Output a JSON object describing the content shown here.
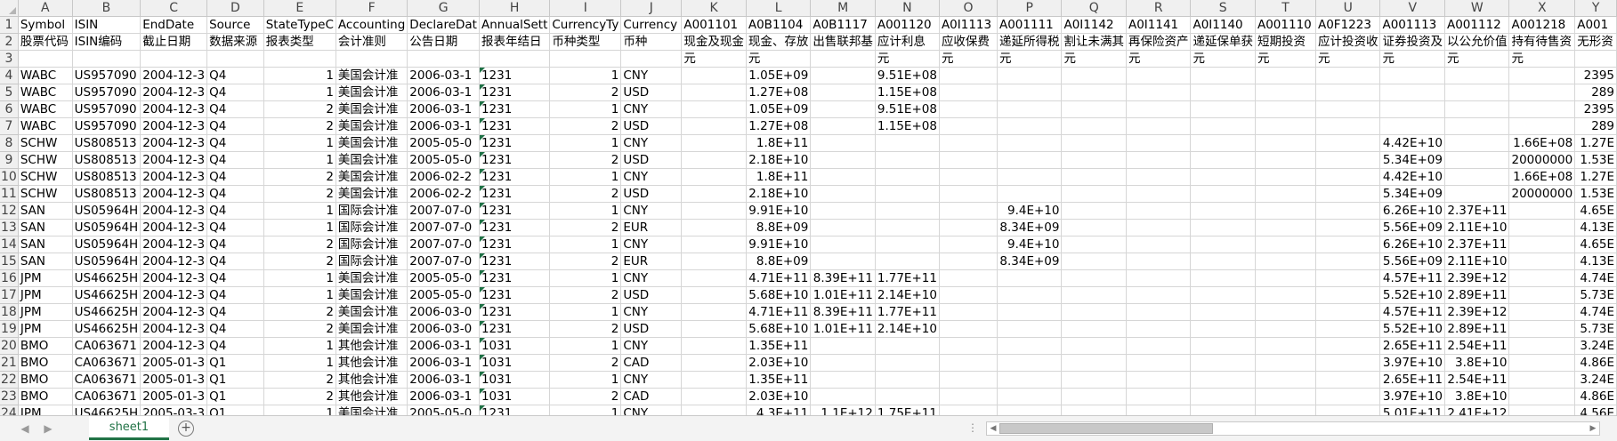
{
  "columns": [
    "A",
    "B",
    "C",
    "D",
    "E",
    "F",
    "G",
    "H",
    "I",
    "J",
    "K",
    "L",
    "M",
    "N",
    "O",
    "P",
    "Q",
    "R",
    "S",
    "T",
    "U",
    "V",
    "W",
    "X",
    "Y"
  ],
  "rows": [
    [
      "Symbol",
      "ISIN",
      "EndDate",
      "Source",
      "StateTypeC",
      "Accounting",
      "DeclareDat",
      "AnnualSett",
      "CurrencyTy",
      "Currency",
      "A001101",
      "A0B1104",
      "A0B1117",
      "A001120",
      "A0I1113",
      "A001111",
      "A0I1142",
      "A0I1141",
      "A0I1140",
      "A001110",
      "A0F1223",
      "A001113",
      "A001112",
      "A001218",
      "A001"
    ],
    [
      "股票代码",
      "ISIN编码",
      "截止日期",
      "数据来源",
      "报表类型",
      "会计准则",
      "公告日期",
      "报表年结日",
      "币种类型",
      "币种",
      "现金及现金",
      "现金、存放",
      "出售联邦基",
      "应计利息",
      "应收保费",
      "递延所得税",
      "割让未满其",
      "再保险资产",
      "递延保单获",
      "短期投资",
      "应计投资收",
      "证券投资及",
      "以公允价值",
      "持有待售资",
      "无形资"
    ],
    [
      "",
      "",
      "",
      "",
      "",
      "",
      "",
      "",
      "",
      "",
      "元",
      "元",
      "",
      "元",
      "元",
      "元",
      "元",
      "元",
      "元",
      "元",
      "元",
      "元",
      "元",
      "元",
      ""
    ],
    [
      "WABC",
      "US957090",
      "2004-12-3",
      "Q4",
      "1",
      "美国会计准",
      "2006-03-1",
      "1231",
      "1",
      "CNY",
      "",
      "1.05E+09",
      "",
      "9.51E+08",
      "",
      "",
      "",
      "",
      "",
      "",
      "",
      "",
      "",
      "",
      "2395"
    ],
    [
      "WABC",
      "US957090",
      "2004-12-3",
      "Q4",
      "1",
      "美国会计准",
      "2006-03-1",
      "1231",
      "2",
      "USD",
      "",
      "1.27E+08",
      "",
      "1.15E+08",
      "",
      "",
      "",
      "",
      "",
      "",
      "",
      "",
      "",
      "",
      "289"
    ],
    [
      "WABC",
      "US957090",
      "2004-12-3",
      "Q4",
      "2",
      "美国会计准",
      "2006-03-1",
      "1231",
      "1",
      "CNY",
      "",
      "1.05E+09",
      "",
      "9.51E+08",
      "",
      "",
      "",
      "",
      "",
      "",
      "",
      "",
      "",
      "",
      "2395"
    ],
    [
      "WABC",
      "US957090",
      "2004-12-3",
      "Q4",
      "2",
      "美国会计准",
      "2006-03-1",
      "1231",
      "2",
      "USD",
      "",
      "1.27E+08",
      "",
      "1.15E+08",
      "",
      "",
      "",
      "",
      "",
      "",
      "",
      "",
      "",
      "",
      "289"
    ],
    [
      "SCHW",
      "US808513",
      "2004-12-3",
      "Q4",
      "1",
      "美国会计准",
      "2005-05-0",
      "1231",
      "1",
      "CNY",
      "",
      "1.8E+11",
      "",
      "",
      "",
      "",
      "",
      "",
      "",
      "",
      "",
      "4.42E+10",
      "",
      "1.66E+08",
      "1.27E"
    ],
    [
      "SCHW",
      "US808513",
      "2004-12-3",
      "Q4",
      "1",
      "美国会计准",
      "2005-05-0",
      "1231",
      "2",
      "USD",
      "",
      "2.18E+10",
      "",
      "",
      "",
      "",
      "",
      "",
      "",
      "",
      "",
      "5.34E+09",
      "",
      "20000000",
      "1.53E"
    ],
    [
      "SCHW",
      "US808513",
      "2004-12-3",
      "Q4",
      "2",
      "美国会计准",
      "2006-02-2",
      "1231",
      "1",
      "CNY",
      "",
      "1.8E+11",
      "",
      "",
      "",
      "",
      "",
      "",
      "",
      "",
      "",
      "4.42E+10",
      "",
      "1.66E+08",
      "1.27E"
    ],
    [
      "SCHW",
      "US808513",
      "2004-12-3",
      "Q4",
      "2",
      "美国会计准",
      "2006-02-2",
      "1231",
      "2",
      "USD",
      "",
      "2.18E+10",
      "",
      "",
      "",
      "",
      "",
      "",
      "",
      "",
      "",
      "5.34E+09",
      "",
      "20000000",
      "1.53E"
    ],
    [
      "SAN",
      "US05964H",
      "2004-12-3",
      "Q4",
      "1",
      "国际会计准",
      "2007-07-0",
      "1231",
      "1",
      "CNY",
      "",
      "9.91E+10",
      "",
      "",
      "",
      "9.4E+10",
      "",
      "",
      "",
      "",
      "",
      "6.26E+10",
      "2.37E+11",
      "",
      "4.65E"
    ],
    [
      "SAN",
      "US05964H",
      "2004-12-3",
      "Q4",
      "1",
      "国际会计准",
      "2007-07-0",
      "1231",
      "2",
      "EUR",
      "",
      "8.8E+09",
      "",
      "",
      "",
      "8.34E+09",
      "",
      "",
      "",
      "",
      "",
      "5.56E+09",
      "2.11E+10",
      "",
      "4.13E"
    ],
    [
      "SAN",
      "US05964H",
      "2004-12-3",
      "Q4",
      "2",
      "国际会计准",
      "2007-07-0",
      "1231",
      "1",
      "CNY",
      "",
      "9.91E+10",
      "",
      "",
      "",
      "9.4E+10",
      "",
      "",
      "",
      "",
      "",
      "6.26E+10",
      "2.37E+11",
      "",
      "4.65E"
    ],
    [
      "SAN",
      "US05964H",
      "2004-12-3",
      "Q4",
      "2",
      "国际会计准",
      "2007-07-0",
      "1231",
      "2",
      "EUR",
      "",
      "8.8E+09",
      "",
      "",
      "",
      "8.34E+09",
      "",
      "",
      "",
      "",
      "",
      "5.56E+09",
      "2.11E+10",
      "",
      "4.13E"
    ],
    [
      "JPM",
      "US46625H",
      "2004-12-3",
      "Q4",
      "1",
      "美国会计准",
      "2005-05-0",
      "1231",
      "1",
      "CNY",
      "",
      "4.71E+11",
      "8.39E+11",
      "1.77E+11",
      "",
      "",
      "",
      "",
      "",
      "",
      "",
      "4.57E+11",
      "2.39E+12",
      "",
      "4.74E"
    ],
    [
      "JPM",
      "US46625H",
      "2004-12-3",
      "Q4",
      "1",
      "美国会计准",
      "2005-05-0",
      "1231",
      "2",
      "USD",
      "",
      "5.68E+10",
      "1.01E+11",
      "2.14E+10",
      "",
      "",
      "",
      "",
      "",
      "",
      "",
      "5.52E+10",
      "2.89E+11",
      "",
      "5.73E"
    ],
    [
      "JPM",
      "US46625H",
      "2004-12-3",
      "Q4",
      "2",
      "美国会计准",
      "2006-03-0",
      "1231",
      "1",
      "CNY",
      "",
      "4.71E+11",
      "8.39E+11",
      "1.77E+11",
      "",
      "",
      "",
      "",
      "",
      "",
      "",
      "4.57E+11",
      "2.39E+12",
      "",
      "4.74E"
    ],
    [
      "JPM",
      "US46625H",
      "2004-12-3",
      "Q4",
      "2",
      "美国会计准",
      "2006-03-0",
      "1231",
      "2",
      "USD",
      "",
      "5.68E+10",
      "1.01E+11",
      "2.14E+10",
      "",
      "",
      "",
      "",
      "",
      "",
      "",
      "5.52E+10",
      "2.89E+11",
      "",
      "5.73E"
    ],
    [
      "BMO",
      "CA063671",
      "2004-12-3",
      "Q4",
      "1",
      "其他会计准",
      "2006-03-1",
      "1031",
      "1",
      "CNY",
      "",
      "1.35E+11",
      "",
      "",
      "",
      "",
      "",
      "",
      "",
      "",
      "",
      "2.65E+11",
      "2.54E+11",
      "",
      "3.24E"
    ],
    [
      "BMO",
      "CA063671",
      "2005-01-3",
      "Q1",
      "1",
      "其他会计准",
      "2006-03-1",
      "1031",
      "2",
      "CAD",
      "",
      "2.03E+10",
      "",
      "",
      "",
      "",
      "",
      "",
      "",
      "",
      "",
      "3.97E+10",
      "3.8E+10",
      "",
      "4.86E"
    ],
    [
      "BMO",
      "CA063671",
      "2005-01-3",
      "Q1",
      "2",
      "其他会计准",
      "2006-03-1",
      "1031",
      "1",
      "CNY",
      "",
      "1.35E+11",
      "",
      "",
      "",
      "",
      "",
      "",
      "",
      "",
      "",
      "2.65E+11",
      "2.54E+11",
      "",
      "3.24E"
    ],
    [
      "BMO",
      "CA063671",
      "2005-01-3",
      "Q1",
      "2",
      "其他会计准",
      "2006-03-1",
      "1031",
      "2",
      "CAD",
      "",
      "2.03E+10",
      "",
      "",
      "",
      "",
      "",
      "",
      "",
      "",
      "",
      "3.97E+10",
      "3.8E+10",
      "",
      "4.86E"
    ],
    [
      "JPM",
      "US46625H",
      "2005-03-3",
      "Q1",
      "1",
      "美国会计准",
      "2005-05-0",
      "1231",
      "1",
      "CNY",
      "",
      "4.3E+11",
      "1.1E+12",
      "1.75E+11",
      "",
      "",
      "",
      "",
      "",
      "",
      "",
      "5.01E+11",
      "2.41E+12",
      "",
      "4.56E"
    ]
  ],
  "sheet_tab": "sheet1",
  "accent_color": "#217346"
}
